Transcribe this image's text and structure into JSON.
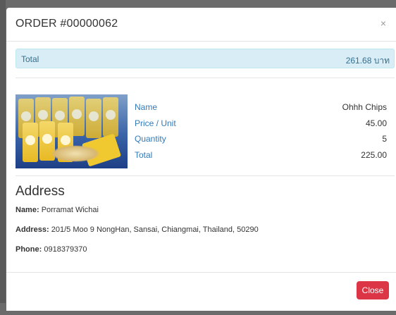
{
  "modal": {
    "title": "ORDER #00000062",
    "close_icon": "×"
  },
  "summary": {
    "total_label": "Total",
    "total_value": "261.68 บาท"
  },
  "item": {
    "image_icon": "product-photo-chips",
    "labels": [
      "Name",
      "Price / Unit",
      "Quantity",
      "Total"
    ],
    "values": [
      "Ohhh Chips",
      "45.00",
      "5",
      "225.00"
    ]
  },
  "address": {
    "heading": "Address",
    "name_label": "Name:",
    "name_value": "Porramat Wichai",
    "address_label": "Address:",
    "address_value": "201/5 Moo 9 NongHan, Sansai, Chiangmai, Thailand, 50290",
    "phone_label": "Phone:",
    "phone_value": "0918379370"
  },
  "footer": {
    "close_label": "Close"
  },
  "colors": {
    "alert_bg": "#d9edf7",
    "link_blue": "#337ab7",
    "danger": "#dc3545"
  }
}
